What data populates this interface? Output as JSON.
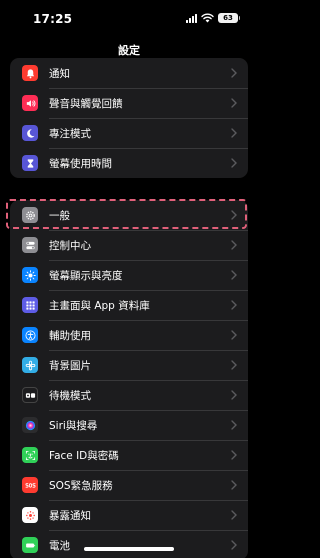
{
  "status": {
    "time": "17:25",
    "battery": "63"
  },
  "nav": {
    "title": "設定"
  },
  "group_a": [
    {
      "label": "通知",
      "icon": "bell-icon",
      "color": "#ff3b30"
    },
    {
      "label": "聲音與觸覺回饋",
      "icon": "speaker-icon",
      "color": "#ff2d55"
    },
    {
      "label": "專注模式",
      "icon": "moon-icon",
      "color": "#5856d6"
    },
    {
      "label": "螢幕使用時間",
      "icon": "hourglass-icon",
      "color": "#5856d6"
    }
  ],
  "group_b": [
    {
      "label": "一般",
      "icon": "gear-icon",
      "color": "#8e8e93"
    },
    {
      "label": "控制中心",
      "icon": "toggles-icon",
      "color": "#8e8e93"
    },
    {
      "label": "螢幕顯示與亮度",
      "icon": "sun-icon",
      "color": "#0a84ff"
    },
    {
      "label": "主畫面與 App 資料庫",
      "icon": "grid-icon",
      "color": "#5e5ce6"
    },
    {
      "label": "輔助使用",
      "icon": "accessibility-icon",
      "color": "#0a84ff"
    },
    {
      "label": "背景圖片",
      "icon": "flower-icon",
      "color": "#32ade6"
    },
    {
      "label": "待機模式",
      "icon": "standby-icon",
      "color": "#1c1c1e"
    },
    {
      "label": "Siri與搜尋",
      "icon": "siri-icon",
      "color": "#2c2c2e"
    },
    {
      "label": "Face ID與密碼",
      "icon": "faceid-icon",
      "color": "#30d158"
    },
    {
      "label": "SOS緊急服務",
      "icon": "sos-icon",
      "color": "#ff3b30"
    },
    {
      "label": "暴露通知",
      "icon": "exposure-icon",
      "color": "#ffffff"
    },
    {
      "label": "電池",
      "icon": "battery-icon",
      "color": "#30d158"
    }
  ]
}
